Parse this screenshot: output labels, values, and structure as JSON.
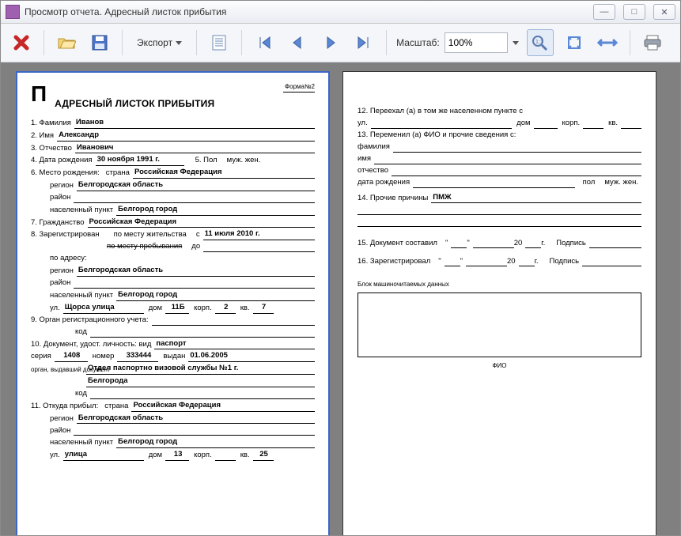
{
  "window": {
    "title": "Просмотр отчета. Адресный листок прибытия"
  },
  "toolbar": {
    "export_label": "Экспорт",
    "zoom_label": "Масштаб:",
    "zoom_value": "100%"
  },
  "doc": {
    "form_no": "Форма№2",
    "big_letter": "П",
    "title": "АДРЕСНЫЙ ЛИСТОК ПРИБЫТИЯ",
    "f1_label": "1. Фамилия",
    "f1_val": "Иванов",
    "f2_label": "2. Имя",
    "f2_val": "Александр",
    "f3_label": "3. Отчество",
    "f3_val": "Иванович",
    "f4_label": "4. Дата рождения",
    "f4_val": "30 ноября 1991 г.",
    "f5_label": "5. Пол",
    "f5_opts": "муж.   жен.",
    "f6_label": "6. Место рождения:",
    "country_lbl": "страна",
    "country_val": "Российская Федерация",
    "region_lbl": "регион",
    "region_val": "Белгородская область",
    "district_lbl": "район",
    "district_val": "",
    "city_lbl": "населенный пункт",
    "city_val": "Белгород город",
    "f7_label": "7. Гражданство",
    "f7_val": "Российская Федерация",
    "f8_label": "8. Зарегистрирован",
    "f8_opt1": "по месту жительства",
    "f8_s": "с",
    "f8_date": "11 июля 2010 г.",
    "f8_opt2": "по месту пребывания",
    "f8_do": "до",
    "addr_lbl": "по адресу:",
    "addr_region": "Белгородская область",
    "addr_city": "Белгород город",
    "street_lbl": "ул.",
    "street_val": "Щорса улица",
    "house_lbl": "дом",
    "house_val": "11Б",
    "korp_lbl": "корп.",
    "korp_val": "2",
    "kv_lbl": "кв.",
    "kv_val": "7",
    "f9_label": "9. Орган регистрационного учета:",
    "code_lbl": "код",
    "f10_label": "10. Документ, удост. личность: вид",
    "f10_val": "паспорт",
    "series_lbl": "серия",
    "series_val": "1408",
    "num_lbl": "номер",
    "num_val": "333444",
    "issued_lbl": "выдан",
    "issued_val": "01.06.2005",
    "org_lbl": "орган, выдавший документ",
    "org_val1": "Отдел паспортно визовой службы №1 г.",
    "org_val2": "Белгорода",
    "f11_label": "11. Откуда прибыл:",
    "from_country": "Российская Федерация",
    "from_region": "Белгородская область",
    "from_city": "Белгород город",
    "from_street_lbl": "ул.",
    "from_street": "улица",
    "from_house": "13",
    "from_korp": "",
    "from_kv": "25",
    "f12_label": "12. Переехал (а) в том же населенном пункте с",
    "f13_label": "13. Переменил (а) ФИО и прочие сведения с:",
    "fam_lbl": "фамилия",
    "name_lbl": "имя",
    "patr_lbl": "отчество",
    "dob_lbl": "дата рождения",
    "pol_lbl": "пол",
    "f14_label": "14. Прочие причины",
    "f14_val": "ПМЖ",
    "f15_label": "15. Документ составил",
    "year20": "20",
    "yr_lbl": "г.",
    "sign_lbl": "Подпись",
    "f16_label": "16. Зарегистрировал",
    "mr_label": "Блок машиночитаемых данных",
    "fio_lbl": "ФИО",
    "q1": "\"",
    "q2": "\""
  }
}
